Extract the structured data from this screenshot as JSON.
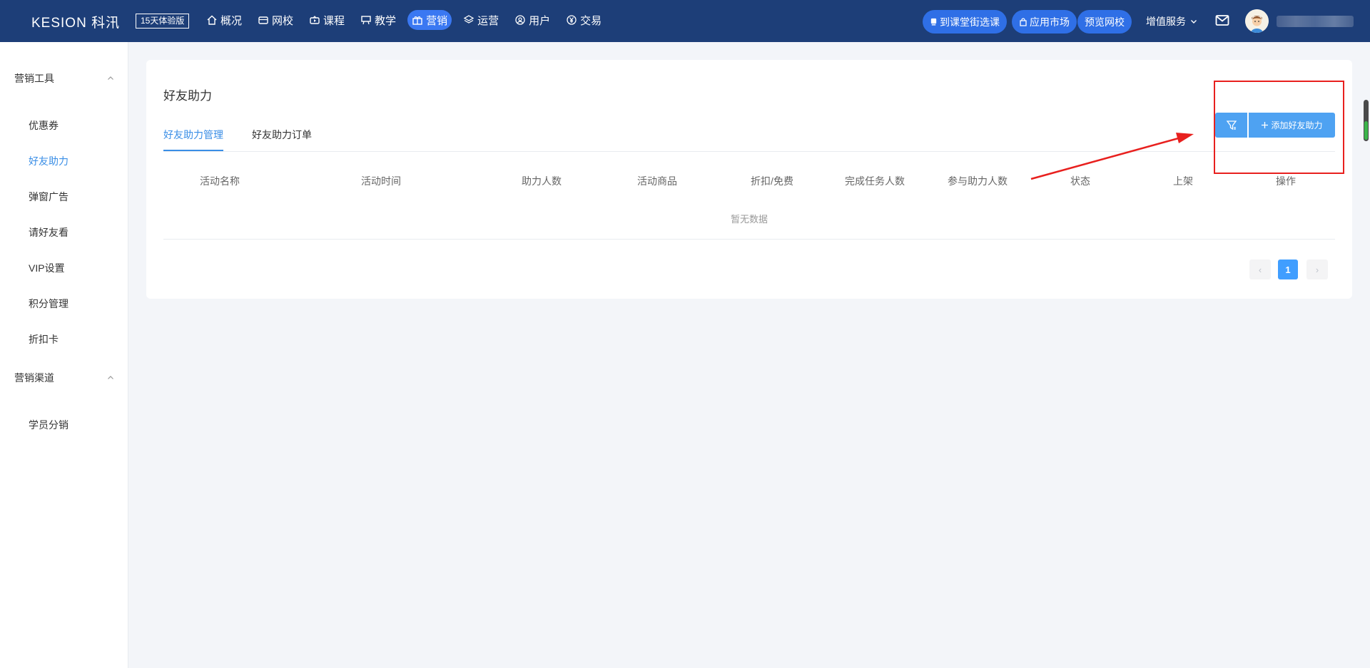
{
  "topbar": {
    "logo": "KESION 科汛",
    "trial_badge": "15天体验版",
    "nav": [
      {
        "label": "概况",
        "icon": "home-icon"
      },
      {
        "label": "网校",
        "icon": "school-icon"
      },
      {
        "label": "课程",
        "icon": "video-icon"
      },
      {
        "label": "教学",
        "icon": "teach-icon"
      },
      {
        "label": "营销",
        "icon": "gift-icon",
        "active": true
      },
      {
        "label": "运营",
        "icon": "layers-icon"
      },
      {
        "label": "用户",
        "icon": "user-icon"
      },
      {
        "label": "交易",
        "icon": "yen-icon"
      }
    ],
    "pill_course_street": "到课堂街选课",
    "pill_app_market": "应用市场",
    "pill_preview": "预览网校",
    "value_added": "增值服务",
    "colors": {
      "bar": "#1d3e78",
      "accent": "#3a78f2"
    }
  },
  "sidebar": {
    "group1": "营销工具",
    "items1": [
      "优惠券",
      "好友助力",
      "弹窗广告",
      "请好友看",
      "VIP设置",
      "积分管理",
      "折扣卡"
    ],
    "active_item": "好友助力",
    "group2": "营销渠道",
    "items2": [
      "学员分销"
    ]
  },
  "main": {
    "title": "好友助力",
    "tabs": [
      "好友助力管理",
      "好友助力订单"
    ],
    "active_tab": "好友助力管理",
    "add_button": "添加好友助力",
    "columns": [
      "活动名称",
      "活动时间",
      "助力人数",
      "活动商品",
      "折扣/免费",
      "完成任务人数",
      "参与助力人数",
      "状态",
      "上架",
      "操作"
    ],
    "empty_text": "暂无数据",
    "pagination": {
      "prev": "‹",
      "current": "1",
      "next": "›"
    }
  }
}
